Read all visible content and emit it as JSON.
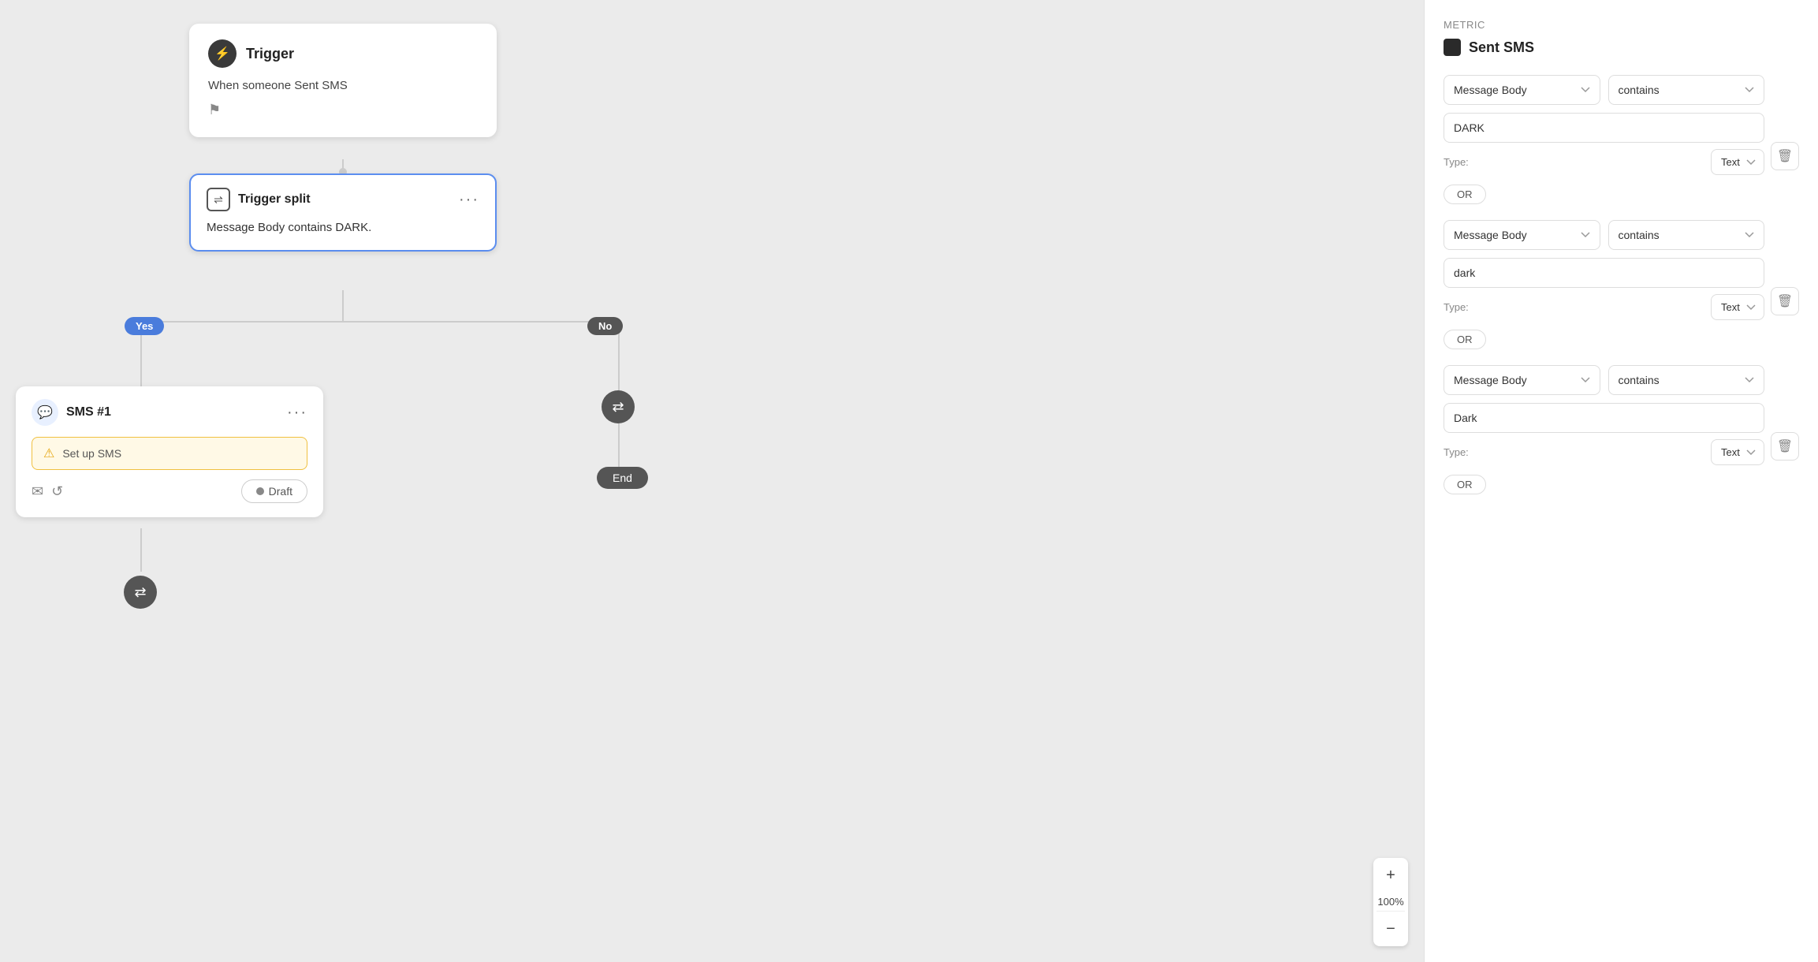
{
  "canvas": {
    "trigger_node": {
      "title": "Trigger",
      "subtitle": "When someone Sent SMS"
    },
    "split_node": {
      "title": "Trigger split",
      "body": "Message Body contains DARK."
    },
    "yes_label": "Yes",
    "no_label": "No",
    "sms_node": {
      "title": "SMS #1",
      "warning_text": "Set up SMS",
      "draft_label": "Draft"
    },
    "end_label": "End",
    "zoom_level": "100%",
    "zoom_plus": "+",
    "zoom_minus": "−"
  },
  "panel": {
    "metric_label": "Metric",
    "metric_value": "Sent SMS",
    "filters": [
      {
        "field": "Message Body",
        "operator": "contains",
        "value": "DARK",
        "type": "Text",
        "or_label": "OR"
      },
      {
        "field": "Message Body",
        "operator": "contains",
        "value": "dark",
        "type": "Text",
        "or_label": "OR"
      },
      {
        "field": "Message Body",
        "operator": "contains",
        "value": "Dark",
        "type": "Text",
        "or_label": "OR"
      }
    ],
    "type_label": "Type:",
    "delete_icon": "🗑"
  }
}
